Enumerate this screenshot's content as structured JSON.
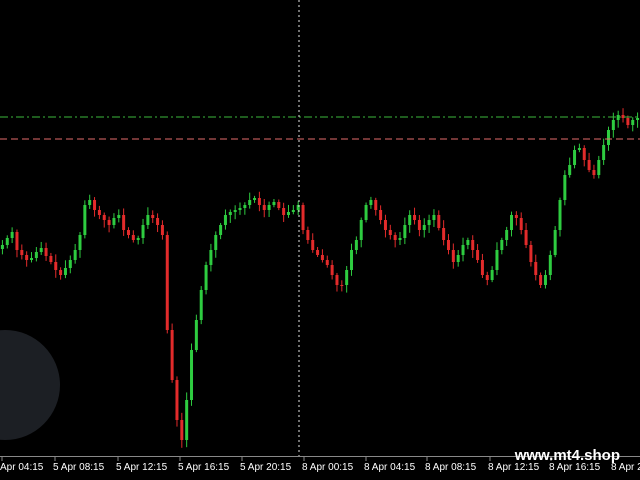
{
  "watermark": "www.mt4.shop",
  "colors": {
    "background": "#000000",
    "bull_candle": "#2ecc40",
    "bear_candle": "#e32b2b",
    "green_level": "#3cb83c",
    "red_level": "#e36b6b",
    "crosshair": "#e6e6e6",
    "axis_text": "#ffffff",
    "overlay_circle": "#1c1f24"
  },
  "chart_data": {
    "type": "candlestick",
    "time_axis_labels": [
      "Apr 04:15",
      "5 Apr 08:15",
      "5 Apr 12:15",
      "5 Apr 16:15",
      "5 Apr 20:15",
      "8 Apr 00:15",
      "8 Apr 04:15",
      "8 Apr 08:15",
      "8 Apr 12:15",
      "8 Apr 16:15",
      "8 Apr 2"
    ],
    "price_levels": [
      {
        "kind": "green-dash-dot",
        "value": 117
      },
      {
        "kind": "red-dashed",
        "value": 139
      }
    ],
    "crosshair_time": "5 Apr 20:15",
    "close_path": [
      245,
      238,
      232,
      250,
      255,
      260,
      258,
      252,
      248,
      256,
      262,
      270,
      275,
      268,
      260,
      250,
      235,
      205,
      200,
      210,
      215,
      220,
      225,
      218,
      215,
      230,
      235,
      240,
      238,
      225,
      215,
      218,
      225,
      235,
      330,
      380,
      420,
      440,
      400,
      350,
      320,
      290,
      265,
      250,
      235,
      225,
      215,
      212,
      210,
      208,
      205,
      200,
      198,
      205,
      210,
      205,
      202,
      208,
      215,
      212,
      210,
      205,
      230,
      240,
      250,
      255,
      260,
      265,
      275,
      285,
      285,
      270,
      250,
      240,
      220,
      205,
      200,
      210,
      220,
      230,
      235,
      240,
      238,
      225,
      215,
      220,
      230,
      225,
      220,
      215,
      228,
      240,
      250,
      262,
      255,
      245,
      240,
      250,
      260,
      275,
      280,
      270,
      250,
      240,
      230,
      215,
      218,
      230,
      245,
      262,
      275,
      285,
      275,
      255,
      230,
      200,
      175,
      165,
      150,
      148,
      160,
      170,
      175,
      160,
      145,
      130,
      120,
      115,
      118,
      125,
      120,
      118
    ]
  }
}
